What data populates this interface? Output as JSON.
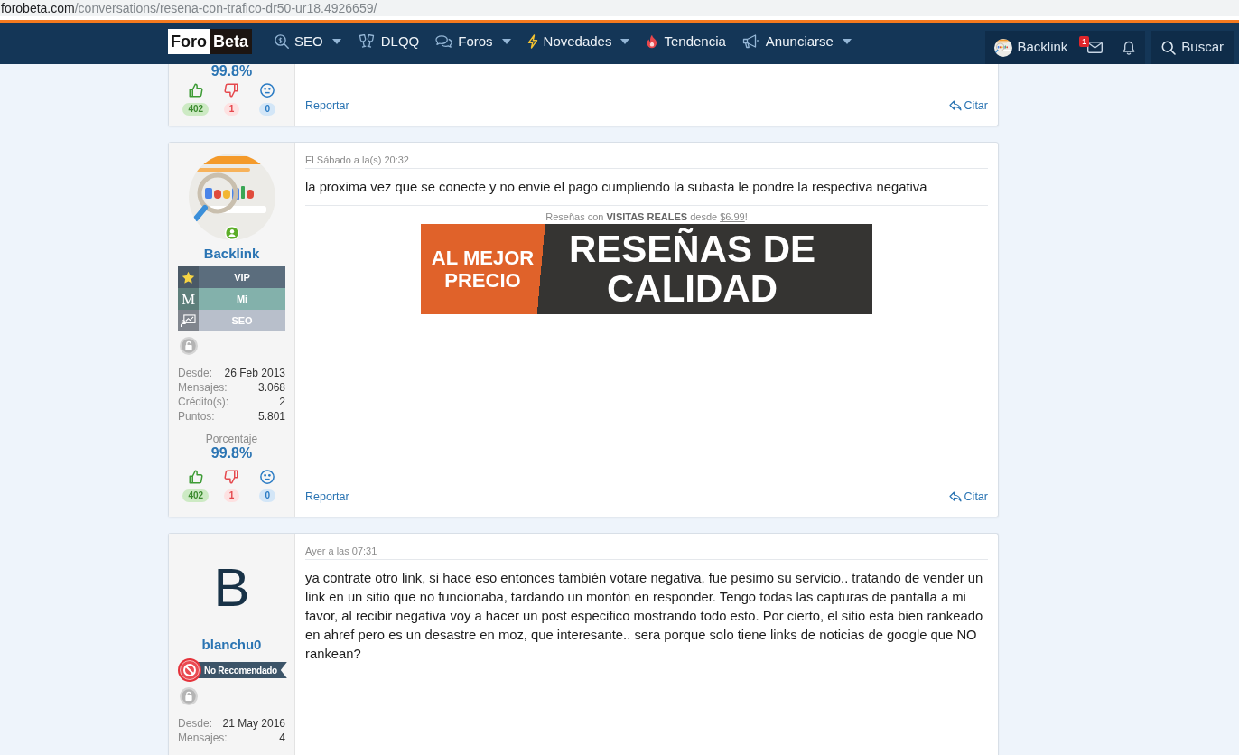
{
  "browser": {
    "url_domain": "forobeta.com",
    "url_path": "/conversations/resena-con-trafico-dr50-ur18.4926659/"
  },
  "header": {
    "logo": {
      "left": "Foro",
      "right": "Beta"
    },
    "nav": [
      {
        "label": "SEO",
        "dropdown": true
      },
      {
        "label": "DLQQ",
        "dropdown": false
      },
      {
        "label": "Foros",
        "dropdown": true
      },
      {
        "label": "Novedades",
        "dropdown": true
      },
      {
        "label": "Tendencia",
        "dropdown": false
      },
      {
        "label": "Anunciarse",
        "dropdown": true
      }
    ],
    "account": {
      "name": "Backlink"
    },
    "inbox": {
      "badge": "1"
    },
    "search": {
      "label": "Buscar"
    }
  },
  "posts": [
    {
      "author": {
        "percentage": "99.8%",
        "votes": [
          {
            "kind": "like",
            "count": "402"
          },
          {
            "kind": "dislike",
            "count": "1"
          },
          {
            "kind": "neutral",
            "count": "0"
          }
        ]
      },
      "actions": {
        "report": "Reportar",
        "quote": "Citar"
      }
    },
    {
      "author": {
        "avatar": {
          "kind": "picture"
        },
        "online": true,
        "name": "Backlink",
        "banners": [
          {
            "kind": "star",
            "label": "VIP",
            "color": "#5b6d7d"
          },
          {
            "kind": "letter",
            "letter": "M",
            "label": "Mi",
            "color": "#83b1ab"
          },
          {
            "kind": "chart",
            "label": "SEO",
            "color": "#b8bfcb"
          }
        ],
        "stats": [
          {
            "label": "Desde:",
            "value": "26 Feb 2013"
          },
          {
            "label": "Mensajes:",
            "value": "3.068"
          },
          {
            "label": "Crédito(s):",
            "value": "2"
          },
          {
            "label": "Puntos:",
            "value": "5.801"
          }
        ],
        "percentage_label": "Porcentaje",
        "percentage": "99.8%",
        "votes": [
          {
            "kind": "like",
            "count": "402"
          },
          {
            "kind": "dislike",
            "count": "1"
          },
          {
            "kind": "neutral",
            "count": "0"
          }
        ]
      },
      "date": "El Sábado a la(s) 20:32",
      "message": "la proxima vez que se conecte y no envie el pago cumpliendo la subasta le pondre la respectiva negativa",
      "ad": {
        "caption": "Reseñas con **VISITAS REALES** desde",
        "price": "$6.99",
        "caption_end": "!",
        "banner_left": "AL MEJOR PRECIO",
        "banner_right": "RESEÑAS DE CALIDAD"
      },
      "actions": {
        "report": "Reportar",
        "quote": "Citar"
      }
    },
    {
      "author": {
        "avatar": {
          "kind": "letter",
          "letter": "B"
        },
        "online": false,
        "name": "blanchu0",
        "badge": {
          "label": "No Recomendado"
        },
        "stats": [
          {
            "label": "Desde:",
            "value": "21 May 2016"
          },
          {
            "label": "Mensajes:",
            "value": "4"
          }
        ]
      },
      "date": "Ayer a las 07:31",
      "message": "ya contrate otro link, si hace eso entonces también votare negativa, fue pesimo su servicio.. tratando de vender un link en un sitio que no funcionaba, tardando un montón en responder. Tengo todas las capturas de pantalla a mi favor, al recibir negativa voy a hacer un post especifico mostrando todo esto. Por cierto, el sitio esta bien rankeado en ahref pero es un desastre en moz, que interesante.. sera porque solo tiene links de noticias de google que NO rankean?"
    }
  ]
}
